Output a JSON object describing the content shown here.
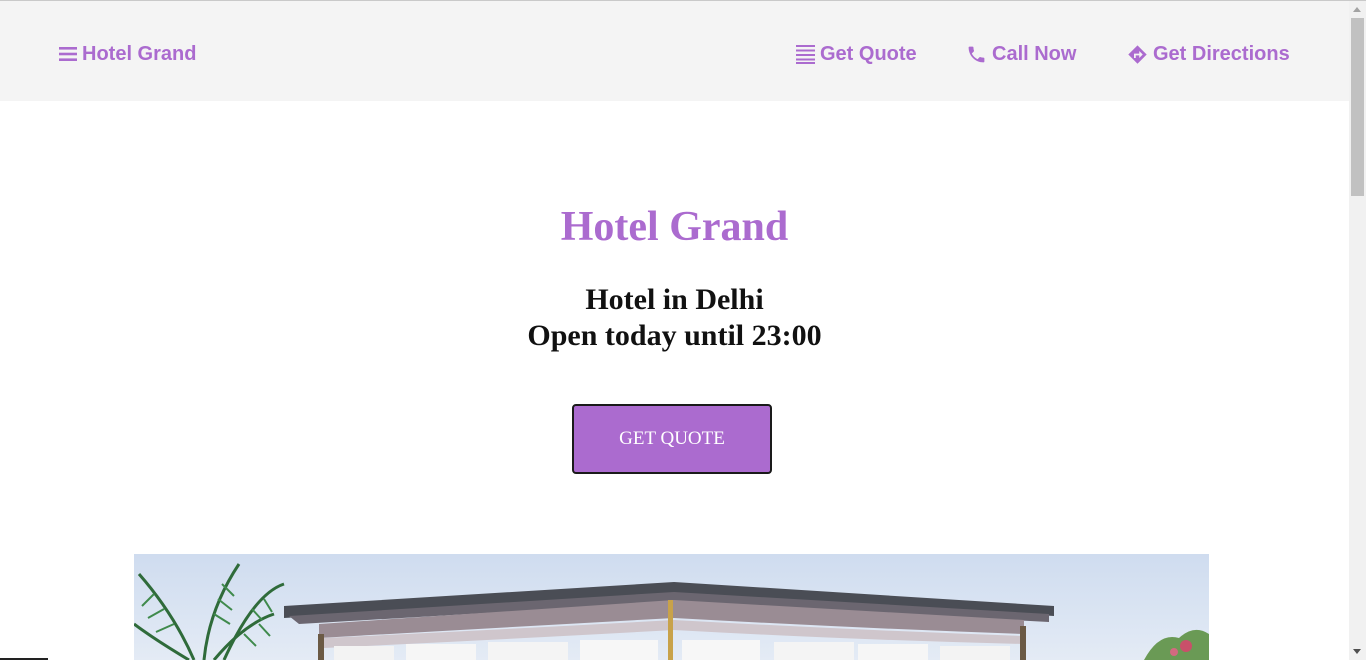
{
  "nav": {
    "brand_label": "Hotel Grand",
    "brand_icon": "menu-icon",
    "links": [
      {
        "label": "Get Quote",
        "icon": "list-icon"
      },
      {
        "label": "Call Now",
        "icon": "phone-icon"
      },
      {
        "label": "Get Directions",
        "icon": "directions-icon"
      }
    ]
  },
  "hero": {
    "title": "Hotel Grand",
    "subtitle_line1": "Hotel in Delhi",
    "subtitle_line2": "Open today until 23:00",
    "cta_label": "GET QUOTE"
  },
  "colors": {
    "accent": "#ab6bcf",
    "nav_background": "#f4f4f4",
    "text_dark": "#111111"
  }
}
